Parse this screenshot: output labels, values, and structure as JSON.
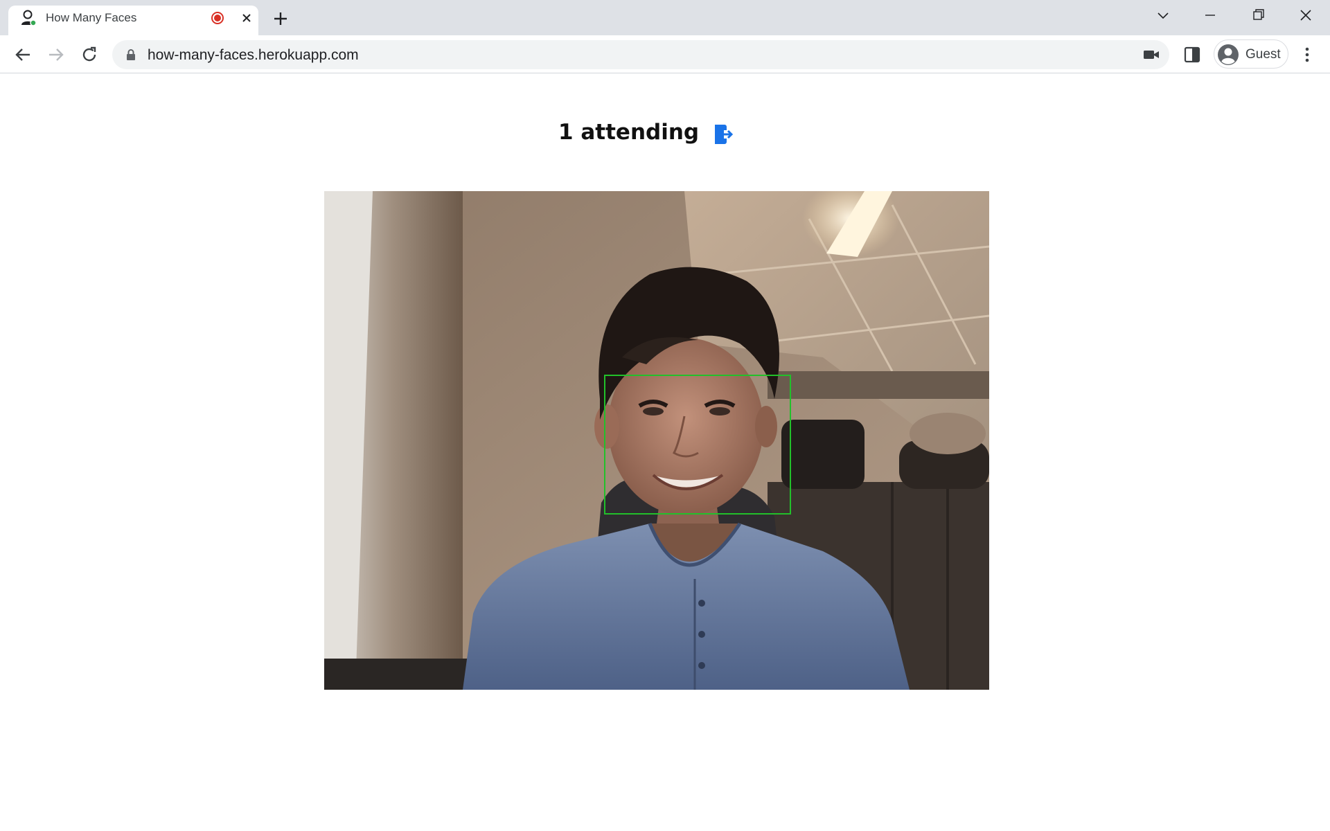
{
  "browser": {
    "tab": {
      "title": "How Many Faces",
      "favicon_icon": "person-icon",
      "recording_icon": "record-icon",
      "close_icon": "close-icon"
    },
    "new_tab_icon": "plus-icon",
    "window_controls": [
      "chevron-down-icon",
      "minimize-icon",
      "restore-icon",
      "close-icon"
    ],
    "nav": [
      "back-icon",
      "forward-icon",
      "reload-icon"
    ],
    "address": {
      "url": "how-many-faces.herokuapp.com",
      "lock_icon": "lock-icon",
      "camera_icon": "camera-icon"
    },
    "side_panel_icon": "side-panel-icon",
    "profile": {
      "label": "Guest",
      "icon": "avatar-icon"
    },
    "menu_icon": "kebab-menu-icon"
  },
  "page": {
    "attending_text": "1 attending",
    "leave_icon": "exit-icon",
    "colors": {
      "accent": "#1a73e8",
      "face_box": "#22c02a"
    }
  }
}
